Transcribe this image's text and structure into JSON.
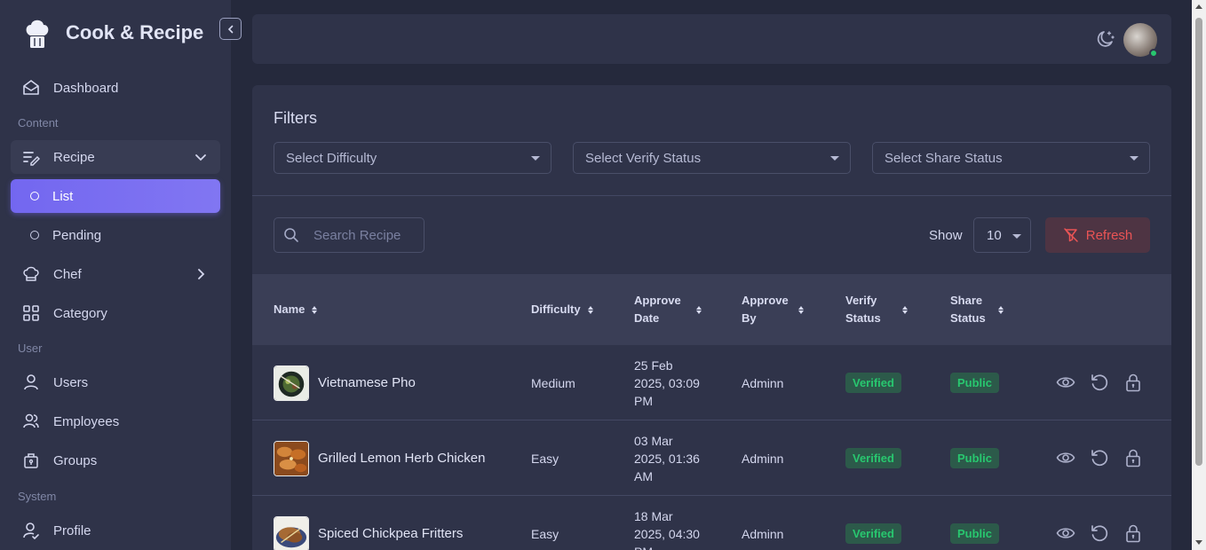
{
  "brand": {
    "name": "Cook & Recipe"
  },
  "sidebar": {
    "dashboard": "Dashboard",
    "sections": {
      "content": "Content",
      "user": "User",
      "system": "System"
    },
    "recipe": "Recipe",
    "recipe_sub": {
      "list": "List",
      "pending": "Pending"
    },
    "chef": "Chef",
    "category": "Category",
    "users": "Users",
    "employees": "Employees",
    "groups": "Groups",
    "profile": "Profile"
  },
  "filters": {
    "title": "Filters",
    "difficulty_placeholder": "Select Difficulty",
    "verify_placeholder": "Select Verify Status",
    "share_placeholder": "Select Share Status"
  },
  "toolbar": {
    "search_placeholder": "Search Recipe",
    "show_label": "Show",
    "page_size": "10",
    "refresh_label": "Refresh"
  },
  "table": {
    "headers": {
      "name": "Name",
      "difficulty": "Difficulty",
      "approve_date_1": "Approve",
      "approve_date_2": "Date",
      "approve_by_1": "Approve",
      "approve_by_2": "By",
      "verify_1": "Verify",
      "verify_2": "Status",
      "share_1": "Share",
      "share_2": "Status"
    },
    "rows": [
      {
        "name": "Vietnamese Pho",
        "difficulty": "Medium",
        "date_1": "25 Feb",
        "date_2": "2025, 03:09",
        "date_3": "PM",
        "approve_by": "Adminn",
        "verify": "Verified",
        "share": "Public"
      },
      {
        "name": "Grilled Lemon Herb Chicken",
        "difficulty": "Easy",
        "date_1": "03 Mar",
        "date_2": "2025, 01:36",
        "date_3": "AM",
        "approve_by": "Adminn",
        "verify": "Verified",
        "share": "Public"
      },
      {
        "name": "Spiced Chickpea Fritters",
        "difficulty": "Easy",
        "date_1": "18 Mar",
        "date_2": "2025, 04:30",
        "date_3": "PM",
        "approve_by": "Adminn",
        "verify": "Verified",
        "share": "Public"
      }
    ]
  },
  "colors": {
    "accent": "#7367f0",
    "success": "#28c76f",
    "danger": "#ea5455"
  }
}
